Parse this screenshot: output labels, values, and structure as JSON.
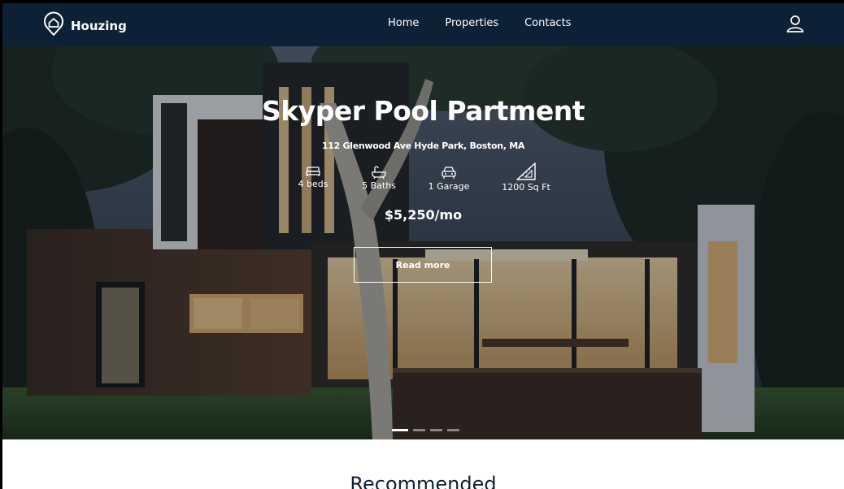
{
  "brand": {
    "name": "Houzing",
    "logo_icon": "house-pin-icon"
  },
  "nav": {
    "links": [
      "Home",
      "Properties",
      "Contacts"
    ],
    "user_icon": "user-icon"
  },
  "hero": {
    "title": "Skyper Pool Partment",
    "address": "112 Glenwood Ave Hyde Park, Boston, MA",
    "features": [
      {
        "icon": "bed-icon",
        "label": "4 beds"
      },
      {
        "icon": "bath-icon",
        "label": "5 Baths"
      },
      {
        "icon": "car-icon",
        "label": "1 Garage"
      },
      {
        "icon": "ruler-icon",
        "label": "1200 Sq Ft"
      }
    ],
    "price": "$5,250/mo",
    "button_label": "Read more",
    "carousel": {
      "total": 4,
      "active": 1
    }
  },
  "recommended": {
    "title": "Recommended"
  },
  "colors": {
    "navbar": "#0d2136",
    "text_light": "#ffffff"
  }
}
